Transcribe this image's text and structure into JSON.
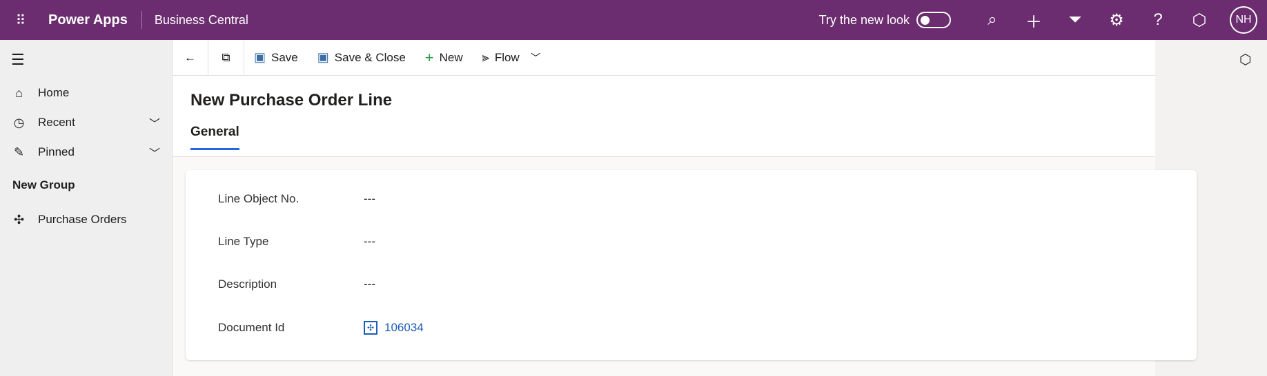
{
  "header": {
    "app_name": "Power Apps",
    "environment": "Business Central",
    "try_new_look": "Try the new look",
    "avatar_initials": "NH"
  },
  "sidebar": {
    "items": [
      {
        "label": "Home"
      },
      {
        "label": "Recent"
      },
      {
        "label": "Pinned"
      }
    ],
    "group": "New Group",
    "group_items": [
      {
        "label": "Purchase Orders"
      }
    ]
  },
  "toolbar": {
    "save": "Save",
    "save_close": "Save & Close",
    "new": "New",
    "flow": "Flow"
  },
  "form": {
    "title": "New Purchase Order Line",
    "tab": "General",
    "fields": [
      {
        "label": "Line Object No.",
        "value": "---"
      },
      {
        "label": "Line Type",
        "value": "---"
      },
      {
        "label": "Description",
        "value": "---"
      },
      {
        "label": "Document Id",
        "value": "106034"
      }
    ]
  }
}
